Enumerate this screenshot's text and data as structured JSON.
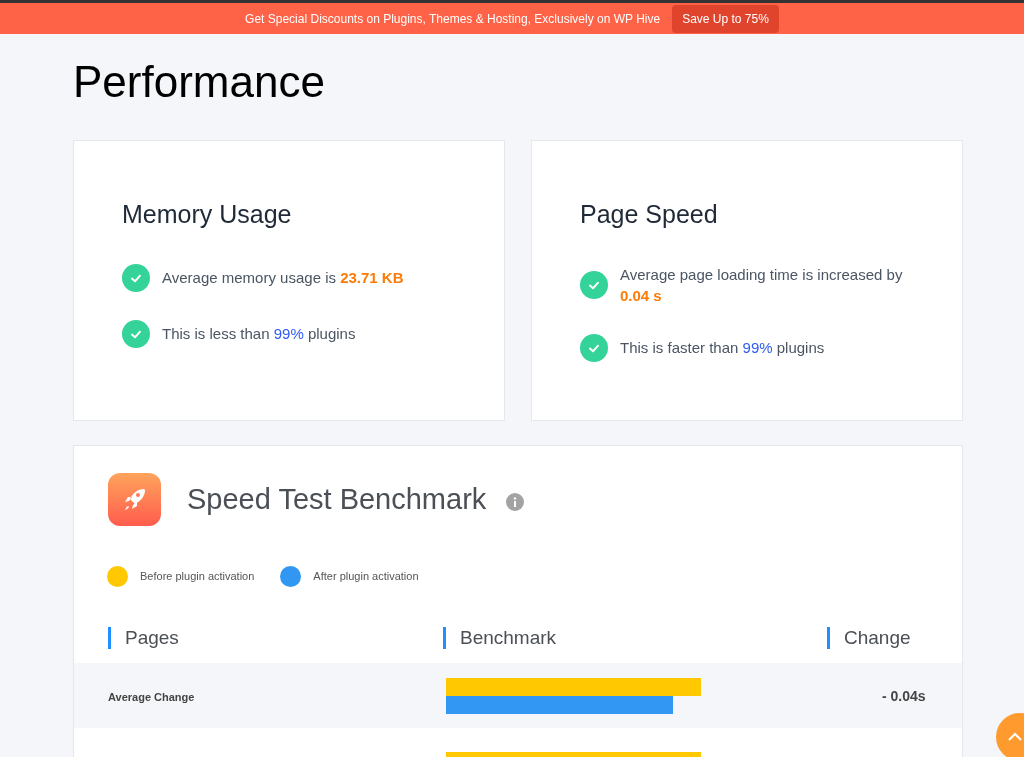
{
  "banner": {
    "text": "Get Special Discounts on Plugins, Themes & Hosting, Exclusively on WP Hive",
    "button": "Save Up to 75%"
  },
  "title": "Performance",
  "cards": [
    {
      "title": "Memory Usage",
      "items": [
        {
          "text": "Average memory usage is",
          "value": "23.71 KB",
          "kind": "highlight"
        },
        {
          "text": "This is less than",
          "value": "99%",
          "suffix": "plugins",
          "kind": "link"
        }
      ]
    },
    {
      "title": "Page Speed",
      "items": [
        {
          "text": "Average page loading time is increased by",
          "value": "0.04 s",
          "kind": "highlight"
        },
        {
          "text": "This is faster than",
          "value": "99%",
          "suffix": "plugins",
          "kind": "link"
        }
      ]
    }
  ],
  "benchmark": {
    "title": "Speed Test Benchmark",
    "legend": [
      {
        "label": "Before plugin activation",
        "color": "#ffc800"
      },
      {
        "label": "After plugin activation",
        "color": "#3197f2"
      }
    ],
    "columns": [
      "Pages",
      "Benchmark",
      "Change"
    ],
    "rows": [
      {
        "page": "Average Change",
        "change": "- 0.04s",
        "bars": [
          {
            "kind": "before"
          },
          {
            "kind": "after"
          }
        ]
      },
      {
        "bars": [
          {
            "kind": "before"
          }
        ]
      }
    ]
  }
}
